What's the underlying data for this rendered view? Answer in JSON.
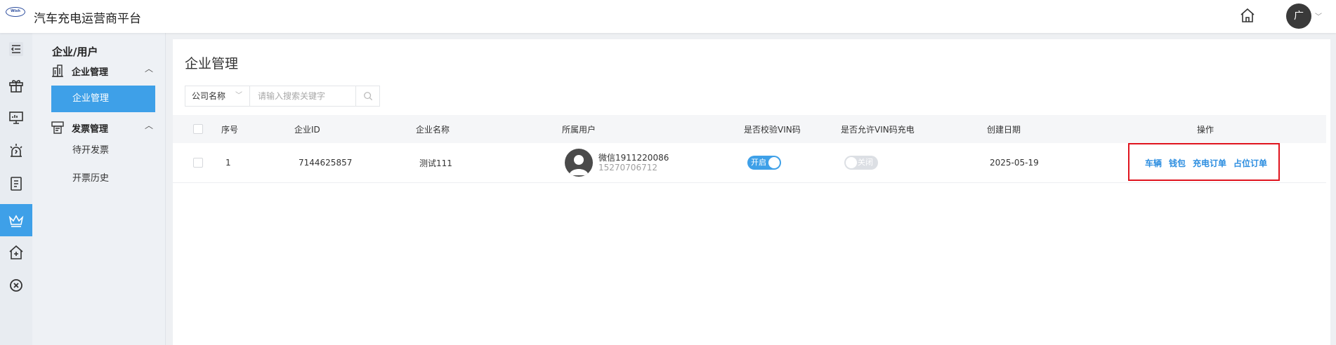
{
  "app": {
    "title": "汽车充电运营商平台",
    "logo_text": "Wish"
  },
  "header": {
    "avatar_initial": "广",
    "caret": "﹀"
  },
  "rail": {
    "icons": [
      "menu-toggle-icon",
      "gift-icon",
      "monitor-icon",
      "alarm-icon",
      "document-icon",
      "crown-icon",
      "house-plus-icon",
      "circle-x-icon"
    ],
    "active_index": 5
  },
  "sidebar": {
    "title": "企业/用户",
    "groups": [
      {
        "label": "企业管理",
        "icon": "building-icon",
        "items": [
          {
            "label": "企业管理",
            "active": true
          }
        ]
      },
      {
        "label": "发票管理",
        "icon": "invoice-icon",
        "items": [
          {
            "label": "待开发票",
            "active": false
          },
          {
            "label": "开票历史",
            "active": false
          }
        ]
      }
    ]
  },
  "main": {
    "title": "企业管理",
    "search": {
      "field_label": "公司名称",
      "placeholder": "请输入搜索关键字"
    },
    "columns": [
      "序号",
      "企业ID",
      "企业名称",
      "所属用户",
      "是否校验VIN码",
      "是否允许VIN码充电",
      "创建日期",
      "操作"
    ],
    "rows": [
      {
        "index": "1",
        "enterprise_id": "7144625857",
        "enterprise_name": "测试111",
        "user_name": "微信1911220086",
        "user_phone": "15270706712",
        "vin_check": {
          "state": "on",
          "label": "开启"
        },
        "vin_charge": {
          "state": "off",
          "label": "关闭"
        },
        "created": "2025-05-19",
        "actions": [
          "车辆",
          "钱包",
          "充电订单",
          "占位订单"
        ]
      }
    ]
  },
  "colors": {
    "accent": "#3ea0e8",
    "link": "#2b8de0",
    "highlight": "#e0141e"
  }
}
